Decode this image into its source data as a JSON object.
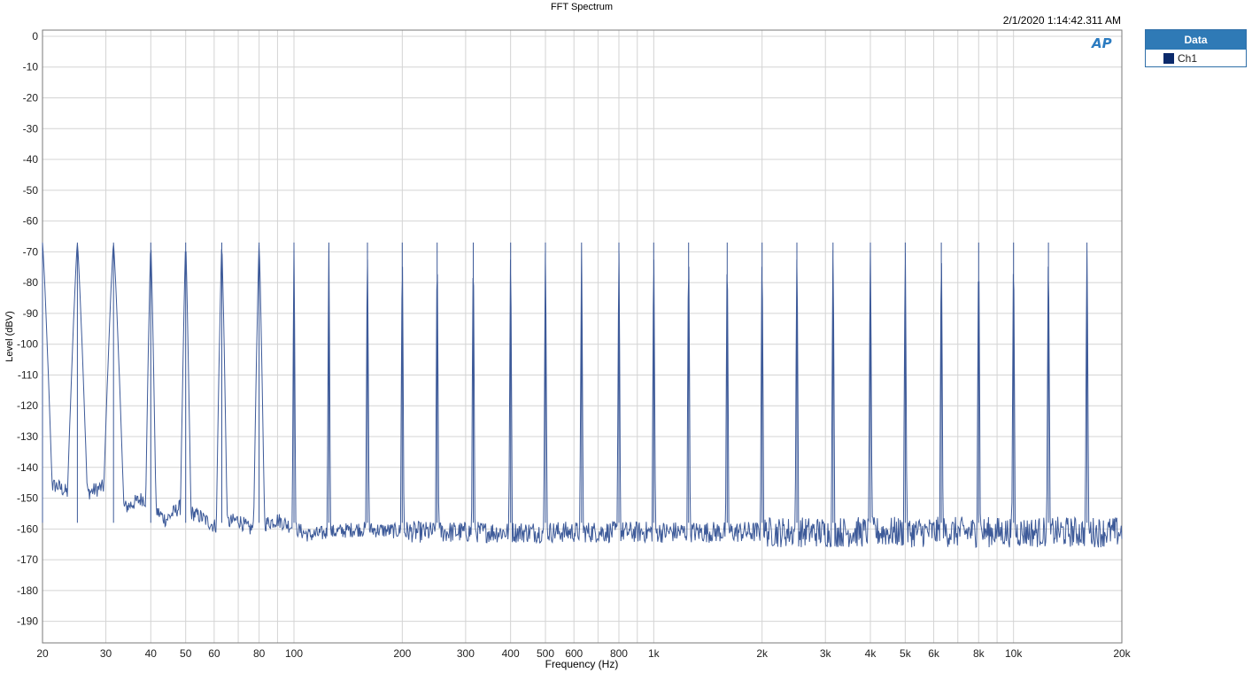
{
  "chart_data": {
    "type": "line",
    "title": "FFT Spectrum",
    "timestamp": "2/1/2020 1:14:42.311 AM",
    "xlabel": "Frequency (Hz)",
    "ylabel": "Level (dBV)",
    "xscale": "log",
    "xlim": [
      20,
      20000
    ],
    "ylim": [
      -197,
      2
    ],
    "x_ticks": [
      20,
      30,
      40,
      50,
      60,
      80,
      100,
      200,
      300,
      400,
      500,
      600,
      800,
      1000,
      2000,
      3000,
      4000,
      5000,
      6000,
      8000,
      10000,
      20000
    ],
    "x_tick_labels": [
      "20",
      "30",
      "40",
      "50",
      "60",
      "80",
      "100",
      "200",
      "300",
      "400",
      "500",
      "600",
      "800",
      "1k",
      "2k",
      "3k",
      "4k",
      "5k",
      "6k",
      "8k",
      "10k",
      "20k"
    ],
    "y_ticks": [
      0,
      -10,
      -20,
      -30,
      -40,
      -50,
      -60,
      -70,
      -80,
      -90,
      -100,
      -110,
      -120,
      -130,
      -140,
      -150,
      -160,
      -170,
      -180,
      -190
    ],
    "y_tick_labels": [
      "0",
      "-10",
      "-20",
      "-30",
      "-40",
      "-50",
      "-60",
      "-70",
      "-80",
      "-90",
      "-100",
      "-110",
      "-120",
      "-130",
      "-140",
      "-150",
      "-160",
      "-170",
      "-180",
      "-190"
    ],
    "grid": true,
    "legend_position": "right",
    "legend_title": "Data",
    "series": [
      {
        "name": "Ch1",
        "color": "#3d5a99",
        "peaks_hz": [
          20,
          25,
          31.5,
          40,
          50,
          63,
          80,
          100,
          125,
          160,
          200,
          250,
          315,
          400,
          500,
          630,
          800,
          1000,
          1250,
          1600,
          2000,
          2500,
          3150,
          4000,
          5000,
          6300,
          8000,
          10000,
          12500,
          16000
        ],
        "peak_level_dbv": -67,
        "noise_floor_dbv": -161,
        "low_freq_floor": [
          [
            22,
            -146
          ],
          [
            24,
            -149
          ],
          [
            27,
            -148
          ],
          [
            30,
            -146
          ],
          [
            34,
            -153
          ],
          [
            38,
            -150
          ],
          [
            44,
            -157
          ],
          [
            48,
            -153
          ],
          [
            55,
            -156
          ],
          [
            60,
            -159
          ],
          [
            70,
            -157
          ],
          [
            75,
            -160
          ],
          [
            90,
            -157
          ],
          [
            110,
            -162
          ],
          [
            150,
            -160
          ],
          [
            220,
            -161
          ]
        ]
      }
    ]
  },
  "legend": {
    "title": "Data",
    "items": [
      {
        "label": "Ch1",
        "swatch_color": "#0b2a6b"
      }
    ]
  },
  "logo": {
    "text": "AP"
  }
}
